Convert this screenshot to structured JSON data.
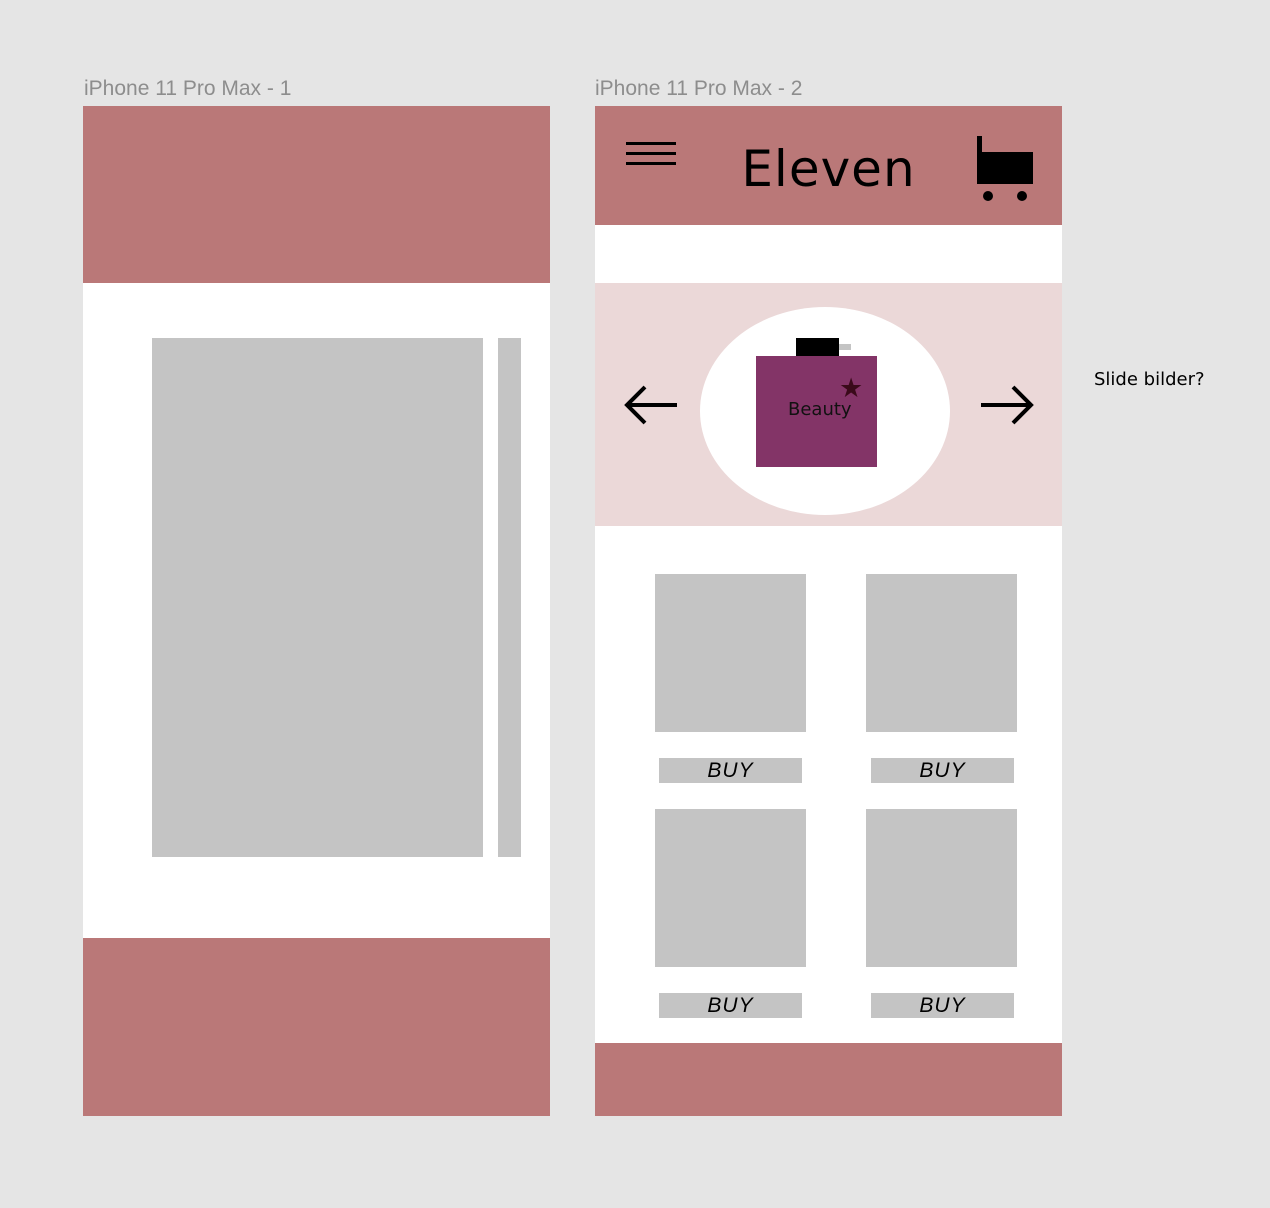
{
  "frames": [
    {
      "title": "iPhone 11 Pro Max - 1"
    },
    {
      "title": "iPhone 11 Pro Max - 2"
    }
  ],
  "app": {
    "brand": "Eleven",
    "product_label": "Beauty",
    "buy_label": "BUY"
  },
  "note": "Slide bilder?",
  "icons": {
    "menu": "hamburger-menu-icon",
    "cart": "shopping-cart-icon",
    "prev": "arrow-left-icon",
    "next": "arrow-right-icon",
    "star": "star-icon"
  },
  "colors": {
    "canvas": "#e5e5e5",
    "accent": "#ba7878",
    "carousel_bg": "#ebd8d8",
    "placeholder": "#c4c4c4",
    "product": "#833467"
  }
}
